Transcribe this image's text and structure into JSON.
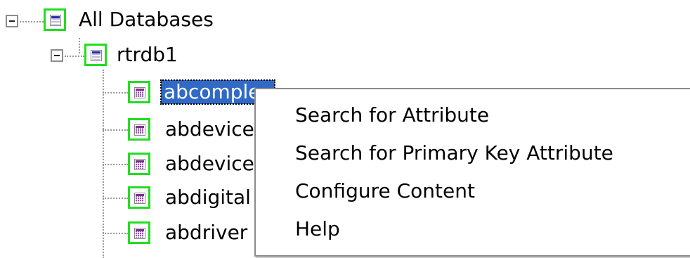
{
  "tree": {
    "root": {
      "label": "All Databases",
      "icon": "database-icon"
    },
    "database": {
      "label": "rtrdb1",
      "icon": "database-icon"
    },
    "tables": [
      {
        "label": "abcomplex",
        "icon": "table-icon",
        "selected": true
      },
      {
        "label": "abdevice",
        "icon": "table-icon"
      },
      {
        "label": "abdevice",
        "icon": "table-icon"
      },
      {
        "label": "abdigital",
        "icon": "table-icon"
      },
      {
        "label": "abdriver",
        "icon": "table-icon"
      }
    ]
  },
  "context_menu": {
    "items": [
      {
        "label": "Search for Attribute"
      },
      {
        "label": "Search for Primary Key Attribute"
      },
      {
        "label": "Configure Content"
      },
      {
        "label": "Help"
      }
    ]
  },
  "colors": {
    "selection": "#316ac5",
    "icon_border": "#22dd22"
  }
}
